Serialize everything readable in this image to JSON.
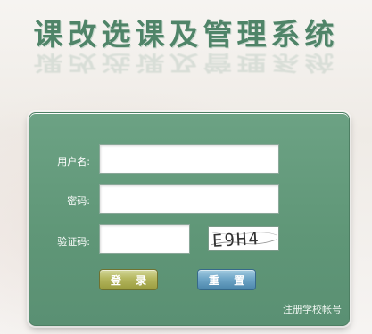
{
  "header": {
    "title": "课改选课及管理系统"
  },
  "login": {
    "username_label": "用户名:",
    "username_value": "",
    "password_label": "密码:",
    "password_value": "",
    "captcha_label": "验证码:",
    "captcha_value": "",
    "captcha_text": "E9H4",
    "login_button": "登 录",
    "reset_button": "重 置",
    "register_link": "注册学校帐号"
  },
  "colors": {
    "panel": "#5f9677",
    "title": "#4f8468",
    "login_button": "#b4b65e",
    "reset_button": "#6fa6c7"
  }
}
